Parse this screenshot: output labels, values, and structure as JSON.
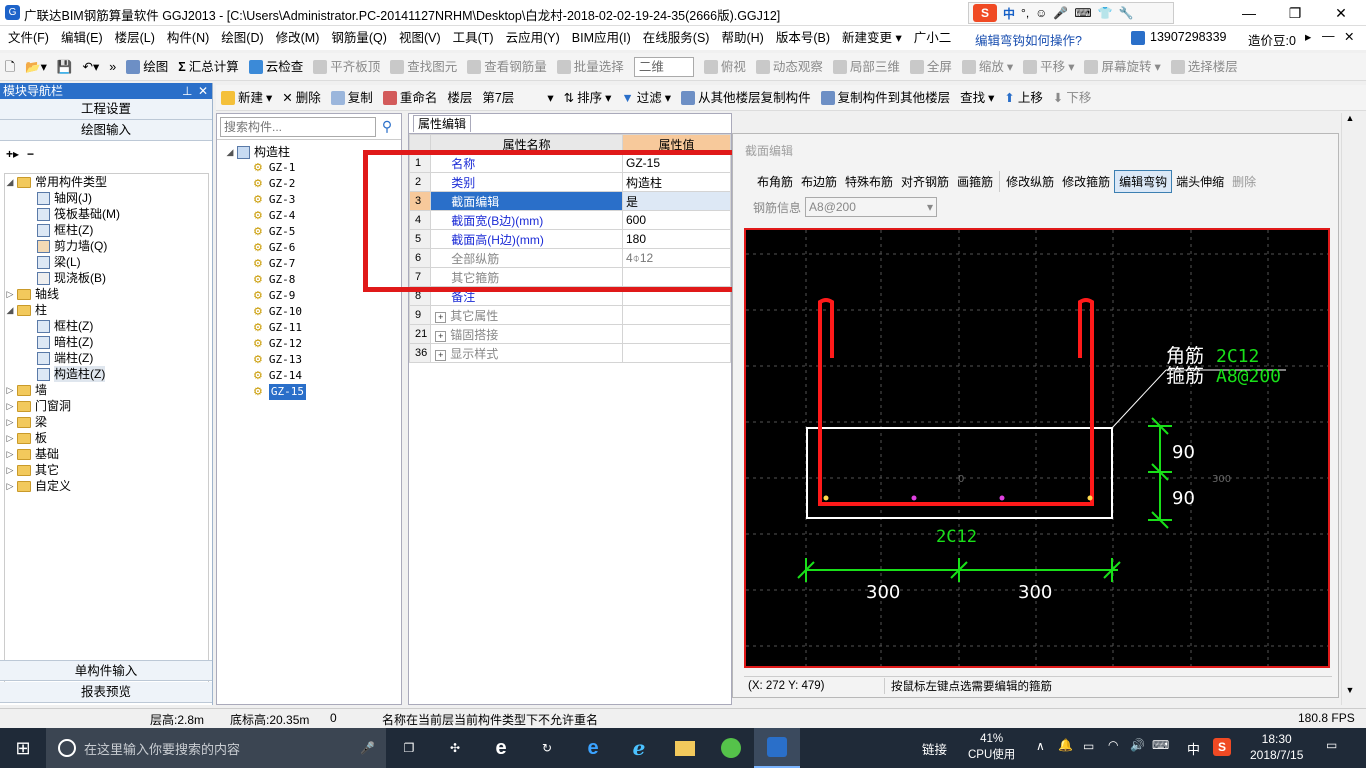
{
  "window": {
    "title": "广联达BIM钢筋算量软件 GGJ2013 - [C:\\Users\\Administrator.PC-20141127NRHM\\Desktop\\白龙村-2018-02-02-19-24-35(2666版).GGJ12]",
    "ime": "中",
    "ime_punct": "°,"
  },
  "menu": [
    "文件(F)",
    "编辑(E)",
    "楼层(L)",
    "构件(N)",
    "绘图(D)",
    "修改(M)",
    "钢筋量(Q)",
    "视图(V)",
    "工具(T)",
    "云应用(Y)",
    "BIM应用(I)",
    "在线服务(S)",
    "帮助(H)",
    "版本号(B)",
    "新建变更 ▾",
    "广小二"
  ],
  "menu_right": {
    "help_link": "编辑弯钩如何操作?",
    "phone": "13907298339",
    "account": "造价豆:0"
  },
  "toolbar1": {
    "items": [
      "绘图",
      "汇总计算",
      "云检查",
      "平齐板顶",
      "查找图元",
      "查看钢筋量",
      "批量选择"
    ],
    "view_select": "二维",
    "items2": [
      "俯视",
      "动态观察",
      "局部三维",
      "全屏",
      "缩放",
      "平移",
      "屏幕旋转",
      "选择楼层"
    ]
  },
  "toolbar2": {
    "items": [
      "新建",
      "删除",
      "复制",
      "重命名",
      "楼层",
      "第7层",
      "排序",
      "过滤",
      "从其他楼层复制构件",
      "复制构件到其他楼层",
      "查找",
      "上移",
      "下移"
    ]
  },
  "nav": {
    "title": "模块导航栏",
    "buttons": [
      "工程设置",
      "绘图输入"
    ],
    "bottom_buttons": [
      "单构件输入",
      "报表预览"
    ],
    "tree": {
      "common": "常用构件类型",
      "common_items": [
        "轴网(J)",
        "筏板基础(M)",
        "框柱(Z)",
        "剪力墙(Q)",
        "梁(L)",
        "现浇板(B)"
      ],
      "axis": "轴线",
      "column": "柱",
      "column_items": [
        "框柱(Z)",
        "暗柱(Z)",
        "端柱(Z)",
        "构造柱(Z)"
      ],
      "others": [
        "墙",
        "门窗洞",
        "梁",
        "板",
        "基础",
        "其它",
        "自定义"
      ]
    }
  },
  "clist": {
    "search_placeholder": "搜索构件...",
    "root": "构造柱",
    "items": [
      "GZ-1",
      "GZ-2",
      "GZ-3",
      "GZ-4",
      "GZ-5",
      "GZ-6",
      "GZ-7",
      "GZ-8",
      "GZ-9",
      "GZ-10",
      "GZ-11",
      "GZ-12",
      "GZ-13",
      "GZ-14",
      "GZ-15"
    ],
    "selected": "GZ-15"
  },
  "props": {
    "tab": "属性编辑",
    "col_name": "属性名称",
    "col_value": "属性值",
    "rows": [
      {
        "num": "1",
        "name": "名称",
        "value": "GZ-15"
      },
      {
        "num": "2",
        "name": "类别",
        "value": "构造柱"
      },
      {
        "num": "3",
        "name": "截面编辑",
        "value": "是"
      },
      {
        "num": "4",
        "name": "截面宽(B边)(mm)",
        "value": "600"
      },
      {
        "num": "5",
        "name": "截面高(H边)(mm)",
        "value": "180"
      },
      {
        "num": "6",
        "name": "全部纵筋",
        "value": "4⌽12"
      },
      {
        "num": "7",
        "name": "其它箍筋",
        "value": ""
      },
      {
        "num": "8",
        "name": "备注",
        "value": ""
      },
      {
        "num": "9",
        "name": "其它属性",
        "value": ""
      },
      {
        "num": "21",
        "name": "锚固搭接",
        "value": ""
      },
      {
        "num": "36",
        "name": "显示样式",
        "value": ""
      }
    ]
  },
  "section": {
    "title": "截面编辑",
    "tools": [
      "布角筋",
      "布边筋",
      "特殊布筋",
      "对齐钢筋",
      "画箍筋",
      "修改纵筋",
      "修改箍筋",
      "编辑弯钩",
      "端头伸缩",
      "删除"
    ],
    "rebar_info_label": "钢筋信息",
    "rebar_info_value": "A8@200",
    "labels": {
      "corner": "角筋",
      "corner_val": "2C12",
      "stirrup": "箍筋",
      "stirrup_val": "A8@200",
      "side": "2C12",
      "h1": "90",
      "h2": "90",
      "w1": "300",
      "w2": "300",
      "origin": "0",
      "axis_num": "300"
    },
    "coords": "(X: 272 Y: 479)",
    "hint": "按鼠标左键点选需要编辑的箍筋"
  },
  "status": {
    "floor_height": "层高:2.8m",
    "base_height": "底标高:20.35m",
    "zero": "0",
    "msg": "名称在当前层当前构件类型下不允许重名",
    "fps": "180.8 FPS"
  },
  "taskbar": {
    "search_placeholder": "在这里输入你要搜索的内容",
    "link": "链接",
    "cpu_pct": "41%",
    "cpu_label": "CPU使用",
    "ime": "中",
    "time": "18:30",
    "date": "2018/7/15"
  },
  "colors": {
    "accent": "#2a6fc9",
    "highlight_box": "#e01919",
    "rebar": "#ff1a1a",
    "dim": "#19e019"
  }
}
